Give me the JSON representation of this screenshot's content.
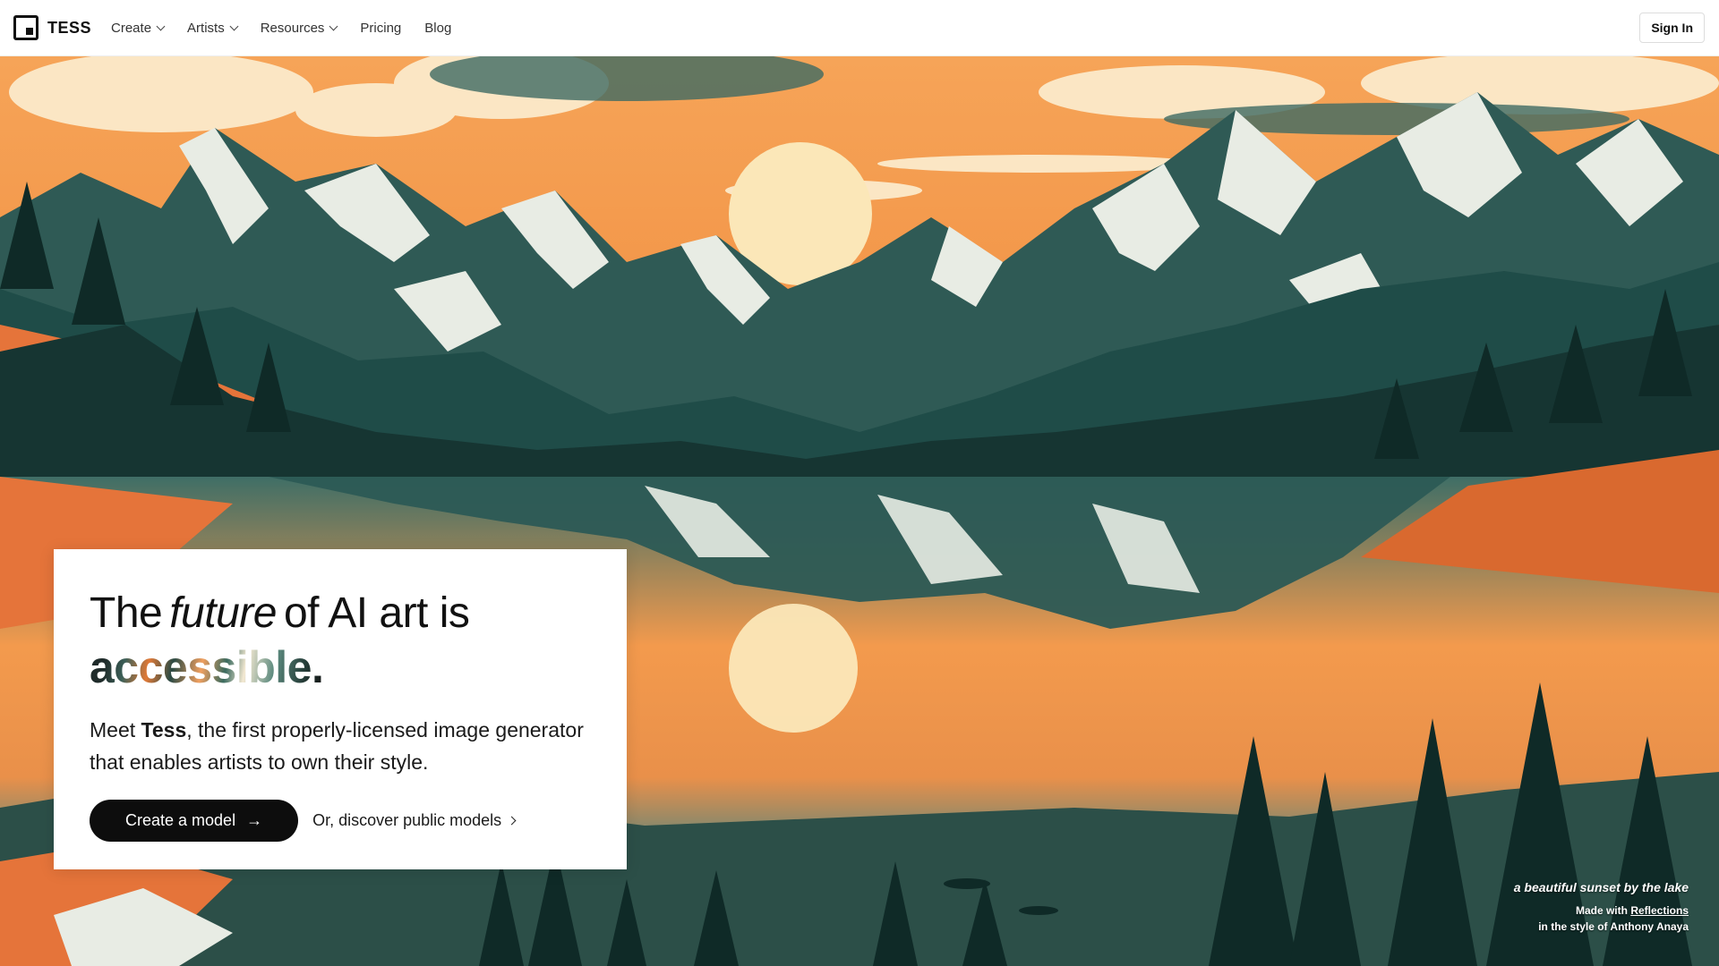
{
  "nav": {
    "brand": "TESS",
    "items": [
      {
        "label": "Create",
        "dropdown": true
      },
      {
        "label": "Artists",
        "dropdown": true
      },
      {
        "label": "Resources",
        "dropdown": true
      },
      {
        "label": "Pricing",
        "dropdown": false
      },
      {
        "label": "Blog",
        "dropdown": false
      }
    ],
    "sign_in": "Sign In"
  },
  "hero": {
    "headline_start": "The",
    "headline_emphasis": "future",
    "headline_end": "of AI art is",
    "headline_accent": "accessible.",
    "sub_prefix": "Meet",
    "sub_brand": "Tess",
    "sub_suffix": ", the first properly-licensed image generator that enables artists to own their style.",
    "cta_primary": "Create a model",
    "cta_primary_icon": "arrow-right-icon",
    "cta_secondary": "Or, discover public models",
    "cta_secondary_icon": "chevron-right-icon"
  },
  "artwork": {
    "prompt": "a beautiful sunset by the lake",
    "made_with_prefix": "Made with",
    "made_with_link": "Reflections",
    "style_credit": "in the style of Anthony Anaya"
  },
  "colors": {
    "sky_orange": "#f39a4d",
    "teal_dark": "#1f4c48",
    "snow": "#e8ece4",
    "sun": "#fbe7b8",
    "button_black": "#0d0d0d"
  }
}
